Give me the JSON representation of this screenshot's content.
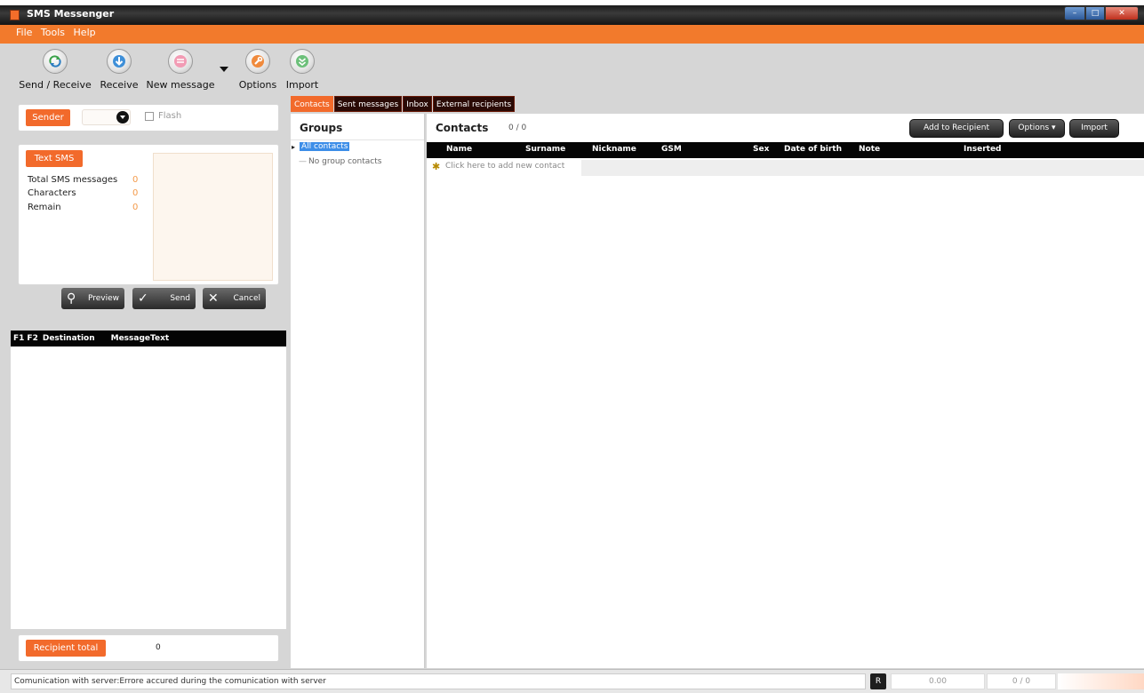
{
  "window": {
    "title": "SMS Messenger"
  },
  "menu": [
    "File",
    "Tools",
    "Help"
  ],
  "toolbar": {
    "send_receive": "Send / Receive",
    "receive": "Receive",
    "new_message": "New message",
    "options": "Options",
    "import": "Import"
  },
  "composer": {
    "sender_label": "Sender",
    "flash_label": "Flash",
    "text_sms_label": "Text SMS",
    "stats": [
      {
        "label": "Total SMS messages",
        "value": "0"
      },
      {
        "label": "Characters",
        "value": "0"
      },
      {
        "label": "Remain",
        "value": "0"
      }
    ],
    "preview_label": "Preview",
    "send_label": "Send",
    "cancel_label": "Cancel"
  },
  "outbox": {
    "columns": [
      "F1",
      "F2",
      "Destination",
      "MessageText"
    ]
  },
  "recipient": {
    "label": "Recipient total",
    "value": "0"
  },
  "tabs": [
    "Contacts",
    "Sent messages",
    "Inbox",
    "External recipients"
  ],
  "groups": {
    "title": "Groups",
    "items": [
      "All contacts",
      "No group contacts"
    ]
  },
  "contacts": {
    "title": "Contacts",
    "count": "0 / 0",
    "add_to_recipient": "Add to Recipient",
    "options": "Options",
    "import": "Import",
    "columns": [
      "Name",
      "Surname",
      "Nickname",
      "GSM",
      "Sex",
      "Date of birth",
      "Note",
      "Inserted"
    ],
    "new_row_hint": "Click here to add new contact"
  },
  "status": {
    "message": "Comunication with server:Errore accured during the comunication with server",
    "r_label": "R",
    "credit": "0.00",
    "counter": "0 / 0"
  }
}
